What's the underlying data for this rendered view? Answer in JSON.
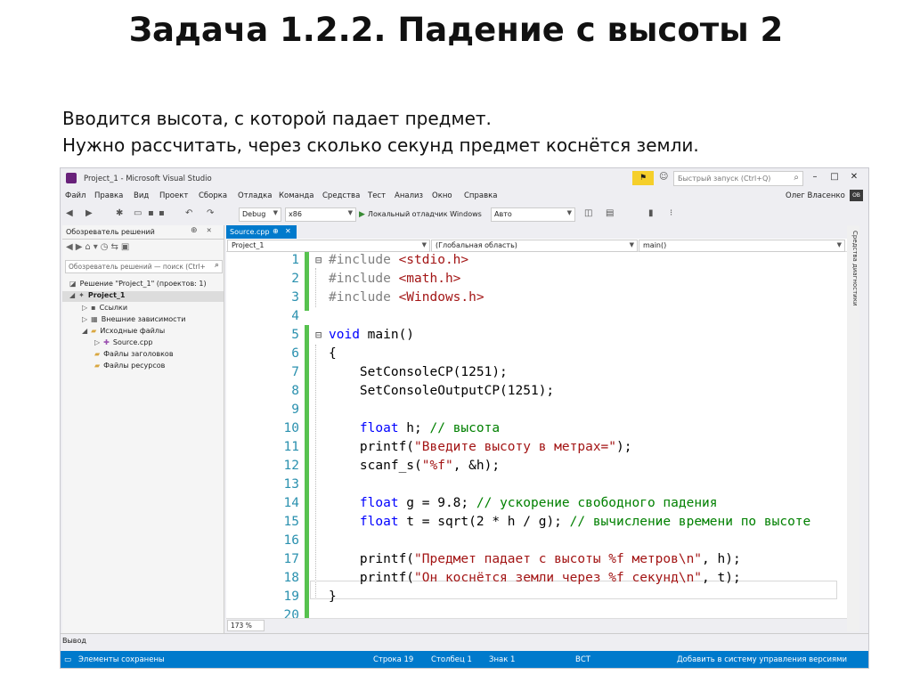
{
  "slide": {
    "title": "Задача 1.2.2. Падение с высоты 2",
    "text_line1": "Вводится высота, с которой падает предмет.",
    "text_line2": "Нужно рассчитать, через сколько секунд предмет коснётся земли."
  },
  "window": {
    "title": "Project_1 - Microsoft Visual Studio",
    "quick_launch_placeholder": "Быстрый запуск (Ctrl+Q)",
    "user_name": "Олег Власенко",
    "user_initials": "ОВ"
  },
  "menu": [
    "Файл",
    "Правка",
    "Вид",
    "Проект",
    "Сборка",
    "Отладка",
    "Команда",
    "Средства",
    "Тест",
    "Анализ",
    "Окно",
    "Справка"
  ],
  "toolbar": {
    "config": "Debug",
    "platform": "x86",
    "debugger": "Локальный отладчик Windows",
    "debugger_mode": "Авто"
  },
  "explorer": {
    "title": "Обозреватель решений",
    "search_placeholder": "Обозреватель решений — поиск (Ctrl+",
    "items": [
      {
        "label": "Решение \"Project_1\" (проектов: 1)"
      },
      {
        "label": "Project_1"
      },
      {
        "label": "Ссылки"
      },
      {
        "label": "Внешние зависимости"
      },
      {
        "label": "Исходные файлы"
      },
      {
        "label": "Source.cpp"
      },
      {
        "label": "Файлы заголовков"
      },
      {
        "label": "Файлы ресурсов"
      }
    ]
  },
  "editor": {
    "tab": "Source.cpp",
    "nav_project": "Project_1",
    "nav_scope": "(Глобальная область)",
    "nav_member": "main()",
    "zoom": "173 %",
    "lines": [
      {
        "n": "1",
        "parts": [
          {
            "c": "pp",
            "t": "#include "
          },
          {
            "c": "st",
            "t": "<stdio.h>"
          }
        ]
      },
      {
        "n": "2",
        "parts": [
          {
            "c": "pp",
            "t": "#include "
          },
          {
            "c": "st",
            "t": "<math.h>"
          }
        ]
      },
      {
        "n": "3",
        "parts": [
          {
            "c": "pp",
            "t": "#include "
          },
          {
            "c": "st",
            "t": "<Windows.h>"
          }
        ]
      },
      {
        "n": "4",
        "parts": []
      },
      {
        "n": "5",
        "parts": [
          {
            "c": "kw",
            "t": "void"
          },
          {
            "c": "",
            "t": " main()"
          }
        ]
      },
      {
        "n": "6",
        "parts": [
          {
            "c": "",
            "t": "{"
          }
        ]
      },
      {
        "n": "7",
        "parts": [
          {
            "c": "",
            "t": "    SetConsoleCP(1251);"
          }
        ]
      },
      {
        "n": "8",
        "parts": [
          {
            "c": "",
            "t": "    SetConsoleOutputCP(1251);"
          }
        ]
      },
      {
        "n": "9",
        "parts": []
      },
      {
        "n": "10",
        "parts": [
          {
            "c": "",
            "t": "    "
          },
          {
            "c": "kw",
            "t": "float"
          },
          {
            "c": "",
            "t": " h; "
          },
          {
            "c": "cm",
            "t": "// высота"
          }
        ]
      },
      {
        "n": "11",
        "parts": [
          {
            "c": "",
            "t": "    printf("
          },
          {
            "c": "st",
            "t": "\"Введите высоту в метрах=\""
          },
          {
            "c": "",
            "t": ");"
          }
        ]
      },
      {
        "n": "12",
        "parts": [
          {
            "c": "",
            "t": "    scanf_s("
          },
          {
            "c": "st",
            "t": "\"%f\""
          },
          {
            "c": "",
            "t": ", &h);"
          }
        ]
      },
      {
        "n": "13",
        "parts": []
      },
      {
        "n": "14",
        "parts": [
          {
            "c": "",
            "t": "    "
          },
          {
            "c": "kw",
            "t": "float"
          },
          {
            "c": "",
            "t": " g = 9.8; "
          },
          {
            "c": "cm",
            "t": "// ускорение свободного падения"
          }
        ]
      },
      {
        "n": "15",
        "parts": [
          {
            "c": "",
            "t": "    "
          },
          {
            "c": "kw",
            "t": "float"
          },
          {
            "c": "",
            "t": " t = sqrt(2 * h / g); "
          },
          {
            "c": "cm",
            "t": "// вычисление времени по высоте"
          }
        ]
      },
      {
        "n": "16",
        "parts": []
      },
      {
        "n": "17",
        "parts": [
          {
            "c": "",
            "t": "    printf("
          },
          {
            "c": "st",
            "t": "\"Предмет падает с высоты %f метров\\n\""
          },
          {
            "c": "",
            "t": ", h);"
          }
        ]
      },
      {
        "n": "18",
        "parts": [
          {
            "c": "",
            "t": "    printf("
          },
          {
            "c": "st",
            "t": "\"Он коснётся земли через %f секунд\\n\""
          },
          {
            "c": "",
            "t": ", t);"
          }
        ]
      },
      {
        "n": "19",
        "parts": [
          {
            "c": "",
            "t": "}"
          }
        ]
      },
      {
        "n": "20",
        "parts": []
      }
    ]
  },
  "right_sidebar": "Средства диагностики",
  "output_title": "Вывод",
  "status": {
    "message": "Элементы сохранены",
    "line": "Строка 19",
    "col": "Столбец 1",
    "char": "Знак 1",
    "mode": "ВСТ",
    "vcs": "Добавить в систему управления версиями"
  }
}
